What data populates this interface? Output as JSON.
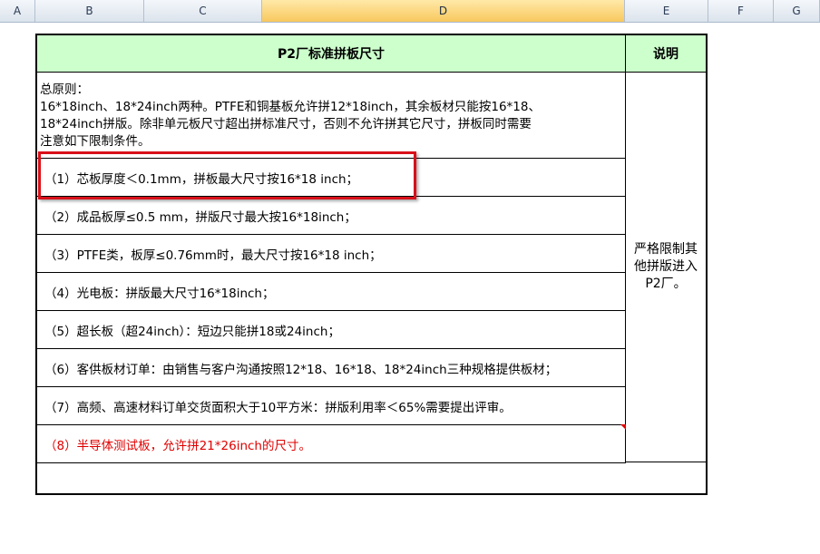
{
  "columns": [
    "A",
    "B",
    "C",
    "D",
    "E",
    "F",
    "G"
  ],
  "active_column": "D",
  "table": {
    "header_title": "P2厂标准拼板尺寸",
    "header_note": "说明",
    "general_lines": [
      "总原则：",
      "16*18inch、18*24inch两种。PTFE和铜基板允许拼12*18inch，其余板材只能按16*18、",
      "18*24inch拼版。除非单元板尺寸超出拼标准尺寸，否则不允许拼其它尺寸，拼板同时需要",
      "注意如下限制条件。"
    ],
    "rules": [
      "（1）芯板厚度＜0.1mm，拼板最大尺寸按16*18 inch；",
      "（2）成品板厚≤0.5 mm，拼版尺寸最大按16*18inch；",
      "（3）PTFE类，板厚≤0.76mm时，最大尺寸按16*18 inch；",
      "（4）光电板：拼版最大尺寸16*18inch；",
      "（5）超长板（超24inch）：短边只能拼18或24inch；",
      "（6）客供板材订单：由销售与客户沟通按照12*18、16*18、18*24inch三种规格提供板材；",
      "（7）高频、高速材料订单交货面积大于10平方米：拼版利用率＜65%需要提出评审。",
      "（8）半导体测试板，允许拼21*26inch的尺寸。"
    ],
    "note_lines": [
      "严格限制其",
      "他拼版进入",
      "P2厂。"
    ]
  },
  "colors": {
    "header_fill": "#ccffcc",
    "highlight_border": "#d9101a",
    "red_text": "#e00000",
    "active_column": "#f8c85e"
  }
}
